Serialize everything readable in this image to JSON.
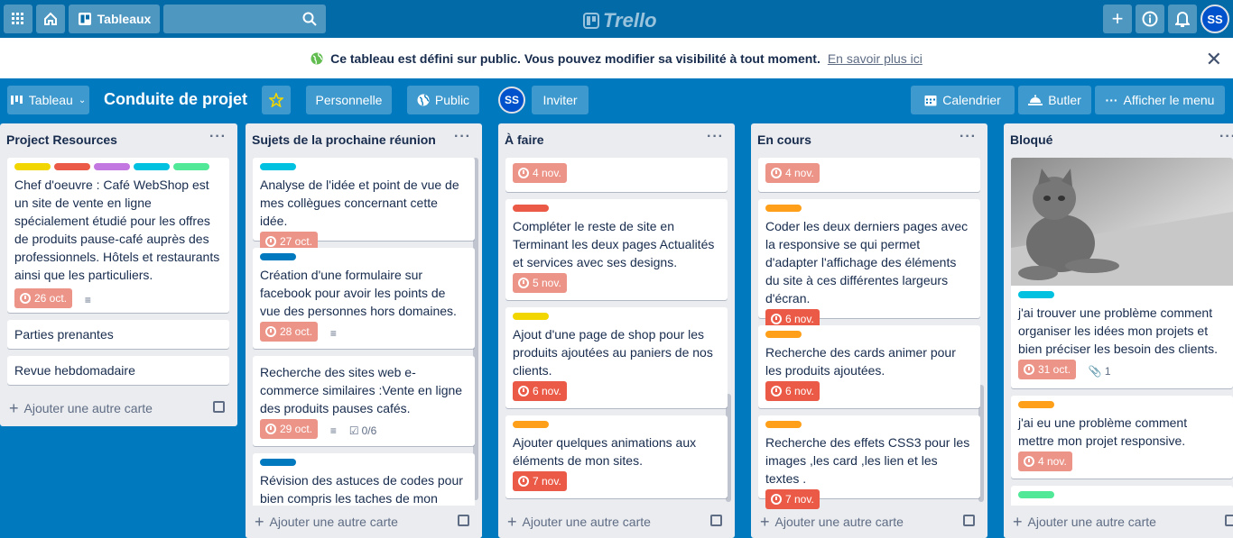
{
  "topbar": {
    "boards_label": "Tableaux",
    "logo_text": "Trello",
    "avatar": "SS"
  },
  "banner": {
    "message": "Ce tableau est défini sur public. Vous pouvez modifier sa visibilité à tout moment.",
    "link": "En savoir plus ici"
  },
  "boardbar": {
    "view_label": "Tableau",
    "title": "Conduite de projet",
    "team_label": "Personnelle",
    "visibility_label": "Public",
    "member_avatar": "SS",
    "invite_label": "Inviter",
    "calendar_label": "Calendrier",
    "butler_label": "Butler",
    "menu_label": "Afficher le menu"
  },
  "add_card_label": "Ajouter une autre carte",
  "colors": {
    "board_bg": "#0079bf",
    "topbar": "#026aa7",
    "green": "#61bd4f",
    "yellow": "#f2d600",
    "orange": "#ff9f1a",
    "red": "#eb5a46",
    "purple": "#c377e0",
    "sky": "#00c2e0",
    "lime": "#51e898",
    "blue": "#0079bf"
  },
  "lists": [
    {
      "title": "Project Resources",
      "cards": [
        {
          "labels": [
            "yellow",
            "red",
            "purple",
            "sky",
            "lime"
          ],
          "text": "Chef d'oeuvre : Café WebShop est un site de vente en ligne spécialement étudié pour les offres de produits pause-café auprès des professionnels. Hôtels et restaurants ainsi que les particuliers.",
          "due": "26 oct.",
          "due_state": "past",
          "description": true
        },
        {
          "labels": [],
          "text": "Parties prenantes"
        },
        {
          "labels": [],
          "text": "Revue hebdomadaire"
        }
      ]
    },
    {
      "title": "Sujets de la prochaine réunion",
      "cards": [
        {
          "labels": [
            "sky"
          ],
          "text": "Analyse de l'idée et point de vue de mes collègues concernant cette idée.",
          "due": "27 oct.",
          "due_state": "past"
        },
        {
          "labels": [
            "blue"
          ],
          "text": "Création d'une formulaire sur facebook pour avoir les points de vue des personnes hors domaines.",
          "due": "28 oct.",
          "due_state": "past",
          "description": true
        },
        {
          "labels": [],
          "text": "Recherche des sites web e-commerce similaires :Vente en ligne des produits pauses cafés.",
          "due": "29 oct.",
          "due_state": "past",
          "description": true,
          "checklist": "0/6"
        },
        {
          "labels": [
            "blue"
          ],
          "text": "Révision des astuces de codes pour bien compris les taches de mon"
        }
      ]
    },
    {
      "title": "À faire",
      "cards": [
        {
          "labels": [],
          "text": "",
          "due": "4 nov.",
          "due_state": "past"
        },
        {
          "labels": [
            "red"
          ],
          "text": "Compléter le reste de site en Terminant les deux pages Actualités et services avec ses designs.",
          "due": "5 nov.",
          "due_state": "past"
        },
        {
          "labels": [
            "yellow"
          ],
          "text": "Ajout d'une page de shop pour les produits ajoutées au paniers de nos clients.",
          "due": "6 nov.",
          "due_state": "due"
        },
        {
          "labels": [
            "orange"
          ],
          "text": "Ajouter quelques animations aux éléments de mon sites.",
          "due": "7 nov.",
          "due_state": "due"
        }
      ]
    },
    {
      "title": "En cours",
      "cards": [
        {
          "labels": [],
          "text": "",
          "due": "4 nov.",
          "due_state": "past"
        },
        {
          "labels": [
            "orange"
          ],
          "text": "Coder les deux derniers pages avec la responsive se qui permet d'adapter l'affichage des éléments du site à ces différentes largeurs d'écran.",
          "due": "6 nov.",
          "due_state": "due"
        },
        {
          "labels": [
            "orange"
          ],
          "text": "Recherche des cards animer pour les produits ajoutées.",
          "due": "6 nov.",
          "due_state": "due"
        },
        {
          "labels": [
            "orange"
          ],
          "text": "Recherche des effets CSS3 pour les images ,les card ,les lien et les textes .",
          "due": "7 nov.",
          "due_state": "due"
        }
      ]
    },
    {
      "title": "Bloqué",
      "cards": [
        {
          "labels": [
            "sky"
          ],
          "text": "j'ai trouver une problème comment organiser les idées mon projets et bien préciser les besoin des clients.",
          "due": "31 oct.",
          "due_state": "past",
          "attachments": "1",
          "cover": true
        },
        {
          "labels": [
            "orange"
          ],
          "text": "j'ai eu une problème comment mettre mon projet responsive.",
          "due": "4 nov.",
          "due_state": "past"
        },
        {
          "labels": [
            "lime"
          ],
          "text": ""
        }
      ]
    }
  ]
}
